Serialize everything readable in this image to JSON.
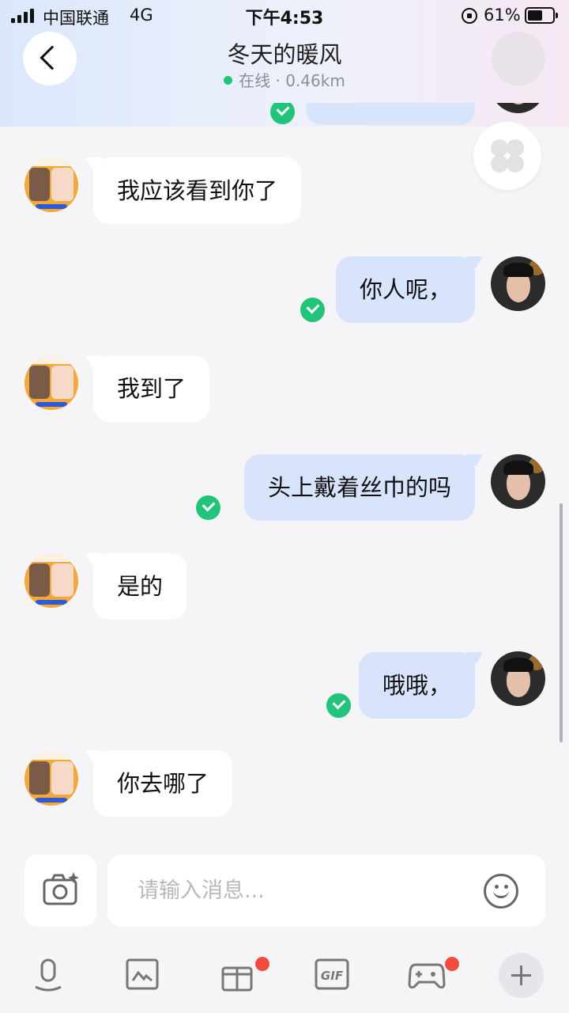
{
  "status_bar": {
    "carrier": "中国联通",
    "network": "4G",
    "time": "下午4:53",
    "battery_percent": "61%",
    "battery_level": 0.61
  },
  "header": {
    "title": "冬天的暖风",
    "status": "在线 · 0.46km",
    "back_icon": "chevron-left-icon",
    "clover_icon": "clover-icon"
  },
  "messages": [
    {
      "side": "in",
      "text": "我应该看到你了"
    },
    {
      "side": "out",
      "text": "你人呢，",
      "read": true
    },
    {
      "side": "in",
      "text": "我到了"
    },
    {
      "side": "out",
      "text": "头上戴着丝巾的吗",
      "read": true
    },
    {
      "side": "in",
      "text": "是的"
    },
    {
      "side": "out",
      "text": "哦哦，",
      "read": true
    },
    {
      "side": "in",
      "text": "你去哪了"
    }
  ],
  "composer": {
    "placeholder": "请输入消息...",
    "camera_icon": "camera-icon",
    "emoji_icon": "emoji-icon"
  },
  "toolbar": {
    "items": [
      {
        "icon": "voice-icon"
      },
      {
        "icon": "image-icon"
      },
      {
        "icon": "gift-icon",
        "badge": true
      },
      {
        "icon": "gif-icon",
        "label": "GIF"
      },
      {
        "icon": "game-icon",
        "badge": true
      },
      {
        "icon": "plus-icon"
      }
    ]
  },
  "colors": {
    "online": "#22c47a",
    "outgoing_bubble": "#d8e4fb",
    "incoming_bubble": "#ffffff",
    "badge": "#f24a3f"
  }
}
